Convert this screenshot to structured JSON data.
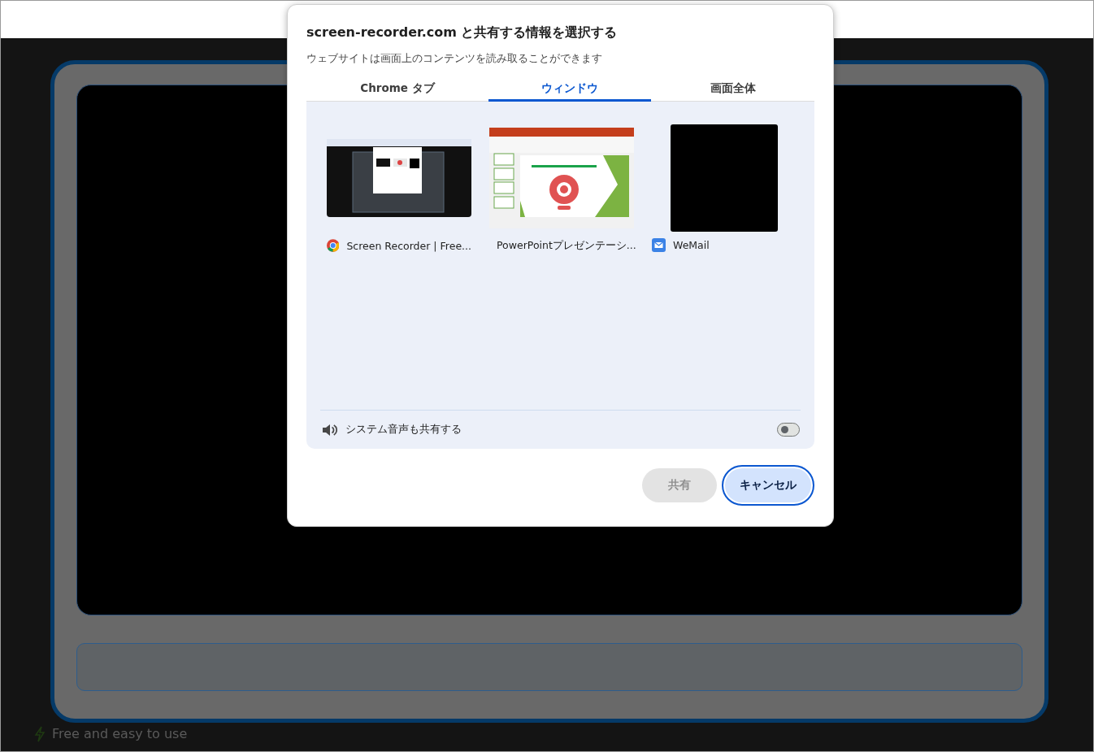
{
  "dialog": {
    "title": "screen-recorder.com と共有する情報を選択する",
    "subtitle": "ウェブサイトは画面上のコンテンツを読み取ることができます",
    "tabs": [
      {
        "label": "Chrome タブ",
        "selected": false
      },
      {
        "label": "ウィンドウ",
        "selected": true
      },
      {
        "label": "画面全体",
        "selected": false
      }
    ],
    "windows": [
      {
        "kind": "browser",
        "name": "Screen Recorder | Free...",
        "selected": false
      },
      {
        "kind": "slides",
        "name": "PowerPointプレゼンテーシ...",
        "selected": false
      },
      {
        "kind": "mail",
        "name": "WeMail",
        "selected": false
      }
    ],
    "audio": {
      "label": "システム音声も共有する",
      "on": false
    },
    "buttons": [
      {
        "label": "共有",
        "disabled": true,
        "focused": false
      },
      {
        "label": "キャンセル",
        "disabled": false,
        "focused": true
      }
    ]
  },
  "background": {
    "features": [
      "Free and easy to use"
    ]
  }
}
